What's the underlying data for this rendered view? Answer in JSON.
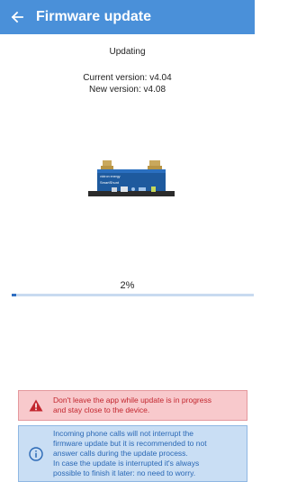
{
  "header": {
    "title": "Firmware update",
    "back_icon": "arrow-left-icon"
  },
  "status": {
    "text": "Updating",
    "current_version": "Current version: v4.04",
    "new_version": "New version: v4.08"
  },
  "device": {
    "icon": "smartshunt-device-image",
    "brand_text": "victron energy",
    "model_text": "SmartShunt"
  },
  "progress": {
    "percent_label": "2%",
    "value": 0.02,
    "fill_color": "#2f6fc2",
    "track_color": "#c8daf0"
  },
  "alerts": {
    "warning": {
      "icon": "warning-triangle-icon",
      "text_line1": "Don't leave the app while update is in progress",
      "text_line2": "and stay close to the device.",
      "color": "#c2262e",
      "background": "#f8c9cc"
    },
    "info": {
      "icon": "info-circle-icon",
      "line1": "Incoming phone calls will not interrupt the",
      "line2": "firmware update but it is recommended to not",
      "line3": "answer calls during the update process.",
      "line4": "In case the update is interrupted it's always",
      "line5": "possible to finish it later: no need to worry.",
      "color": "#2a68b5",
      "background": "#c9def4"
    }
  },
  "colors": {
    "appbar": "#4a90d9"
  }
}
